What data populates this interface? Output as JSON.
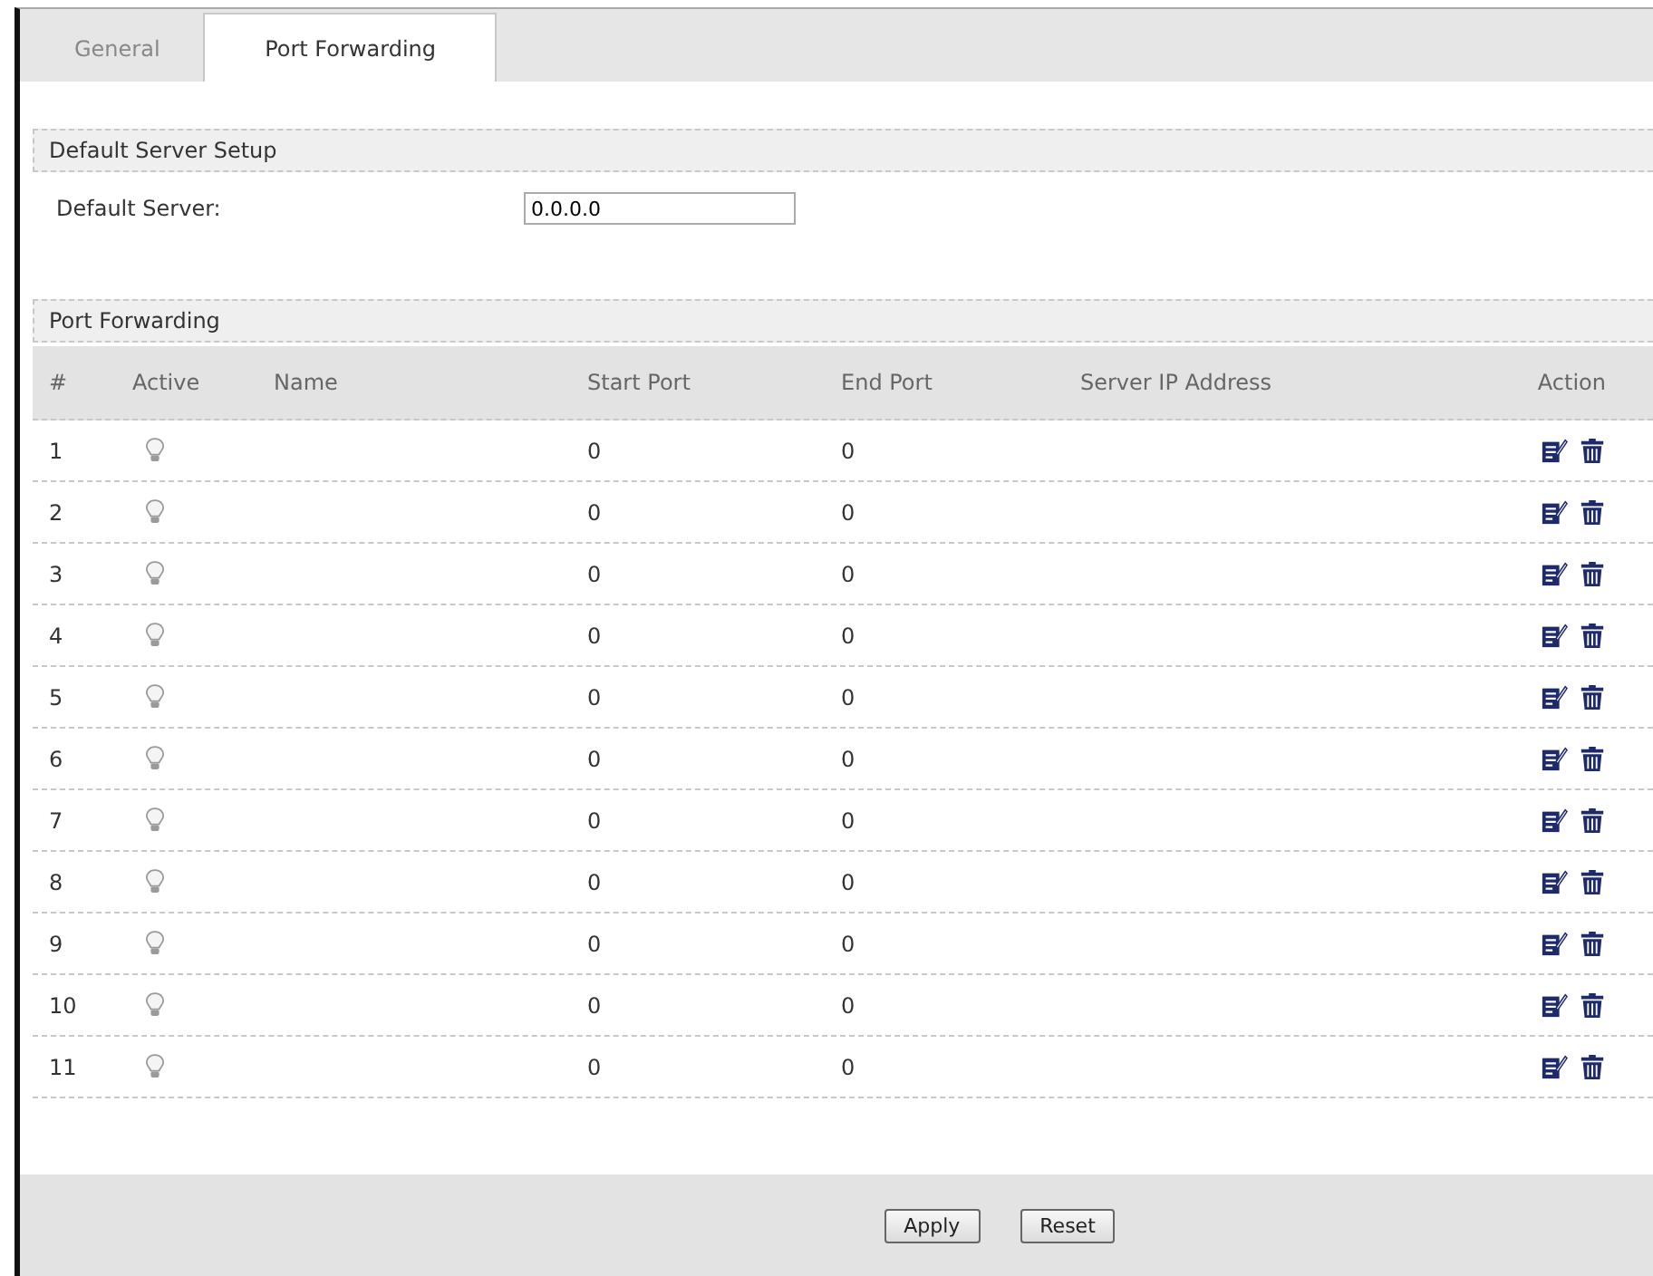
{
  "tabs": [
    {
      "label": "General",
      "selected": false
    },
    {
      "label": "Port Forwarding",
      "selected": true
    }
  ],
  "default_server_setup": {
    "title": "Default Server Setup",
    "field_label": "Default Server:",
    "value": "0.0.0.0"
  },
  "port_forwarding": {
    "title": "Port Forwarding",
    "columns": [
      "#",
      "Active",
      "Name",
      "Start Port",
      "End Port",
      "Server IP Address",
      "Action"
    ],
    "rows": [
      {
        "index": "1",
        "active": false,
        "start_port": "0",
        "end_port": "0"
      },
      {
        "index": "2",
        "active": false,
        "start_port": "0",
        "end_port": "0"
      },
      {
        "index": "3",
        "active": false,
        "start_port": "0",
        "end_port": "0"
      },
      {
        "index": "4",
        "active": false,
        "start_port": "0",
        "end_port": "0"
      },
      {
        "index": "5",
        "active": false,
        "start_port": "0",
        "end_port": "0"
      },
      {
        "index": "6",
        "active": false,
        "start_port": "0",
        "end_port": "0"
      },
      {
        "index": "7",
        "active": false,
        "start_port": "0",
        "end_port": "0"
      },
      {
        "index": "8",
        "active": false,
        "start_port": "0",
        "end_port": "0"
      },
      {
        "index": "9",
        "active": false,
        "start_port": "0",
        "end_port": "0"
      },
      {
        "index": "10",
        "active": false,
        "start_port": "0",
        "end_port": "0"
      },
      {
        "index": "11",
        "active": false,
        "start_port": "0",
        "end_port": "0"
      }
    ]
  },
  "buttons": [
    "Apply",
    "Reset"
  ]
}
